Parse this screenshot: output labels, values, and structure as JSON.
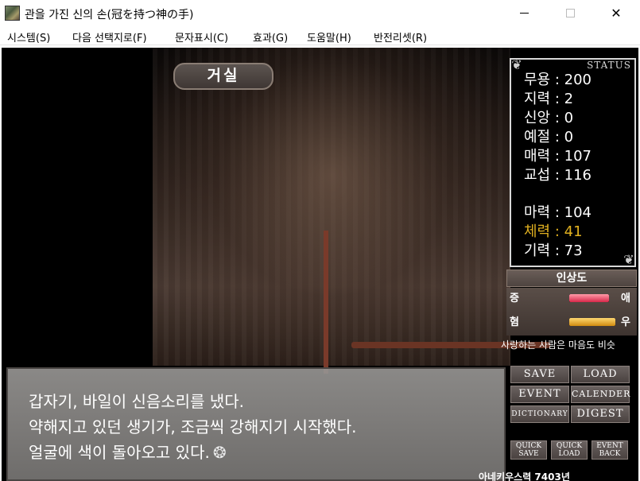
{
  "window": {
    "title": "관을 가진 신의 손(冠を持つ神の手)",
    "min_icon": "minimize-icon",
    "max_icon": "maximize-icon",
    "close_icon": "close-icon",
    "close_glyph": "✕"
  },
  "menu": {
    "items": [
      "시스템(S)",
      "다음 선택지로(F)",
      "문자표시(C)",
      "효과(G)",
      "도움말(H)",
      "반전리셋(R)"
    ]
  },
  "location": "거실",
  "status": {
    "title": "STATUS",
    "stats": [
      "무용 : 200",
      "지력 : 2",
      "신앙 : 0",
      "예절 : 0",
      "매력 : 107",
      "교섭 : 116",
      "마력 : 104",
      "체력 : 41",
      "기력 : 73"
    ],
    "highlight_color": "#e0b020"
  },
  "affinity": {
    "title": "인상도",
    "left_top": "증",
    "right_top": "애",
    "left_bottom": "혐",
    "right_bottom": "우",
    "love_color": "#d8284a",
    "joy_color": "#d08a10"
  },
  "quote": "사랑하는 사람은 마음도 비슷",
  "dialog": {
    "lines": [
      "갑자기, 바일이 신음소리를 냈다.",
      "약해지고 있던 생기가, 조금씩 강해지기 시작했다.",
      "얼굴에 색이 돌아오고 있다."
    ],
    "sparkle": "❂"
  },
  "buttons": {
    "save": "SAVE",
    "load": "LOAD",
    "event": "EVENT",
    "calender": "CALENDER",
    "dictionary": "DICTIONARY",
    "digest": "DIGEST",
    "quick_save_1": "QUICK",
    "quick_save_2": "SAVE",
    "quick_load_1": "QUICK",
    "quick_load_2": "LOAD",
    "event_back_1": "EVENT",
    "event_back_2": "BACK"
  },
  "footer": "아네키우스력 7403년"
}
